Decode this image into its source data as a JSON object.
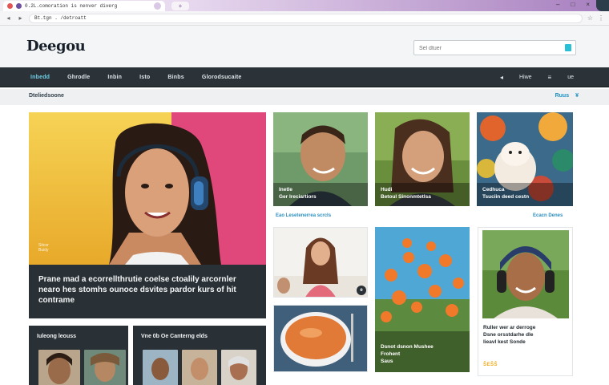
{
  "browser": {
    "tab_title": "0.2L.comoration is nenver diverg",
    "new_tab_label": "+",
    "url": "Bt.tgn . /detroatt",
    "window_controls": [
      "–",
      "□",
      "×"
    ]
  },
  "site": {
    "logo": "Deegou",
    "search_placeholder": "Sel dtuer"
  },
  "nav": {
    "items": [
      "Inbedd",
      "Ghrodle",
      "Inbin",
      "Isto",
      "Binbs",
      "Glorodsucaite"
    ],
    "right_items": [
      "◂",
      "Hiwe",
      "≡",
      "ue"
    ]
  },
  "section": {
    "title": "Dteliedsoone",
    "right_links": [
      "Ruus",
      "¥"
    ]
  },
  "hero": {
    "tag": "Sitcor\nBuidy",
    "headline": "Prane mad a ecorrellthrutie  coelse ctoalily arcornler nearo hes stomhs ounoce dsvites pardor kurs of hit contrame"
  },
  "panels": [
    {
      "title": "Iuleong leouss"
    },
    {
      "title": "Vne 0b Oe Canterng elds"
    }
  ],
  "cards": [
    {
      "caption": "Inetle\nGer Ireciartiors"
    },
    {
      "caption": "Hudi\nBetoul Sinonmtetlsa"
    },
    {
      "caption": "Cedhuca\nTsuciin deed cestn"
    }
  ],
  "strip_left": "Eao Lesetenerrea scrcls",
  "strip_right": "Ecacn Denes",
  "mid_cards": [
    {
      "badge": "e"
    },
    {
      "caption": "Dsnot dsnon Mushee\nFrohent\nSaus"
    }
  ],
  "right_card": {
    "text": "Ruller wer ar derroge\nDsne orsstdarhe dle\nlieavl kest Sonde",
    "stars": "ŠEŠŠ"
  },
  "colors": {
    "nav_bg": "#2b3338",
    "accent": "#27c0d6",
    "link": "#1a8fc0",
    "stars": "#f2a814"
  }
}
